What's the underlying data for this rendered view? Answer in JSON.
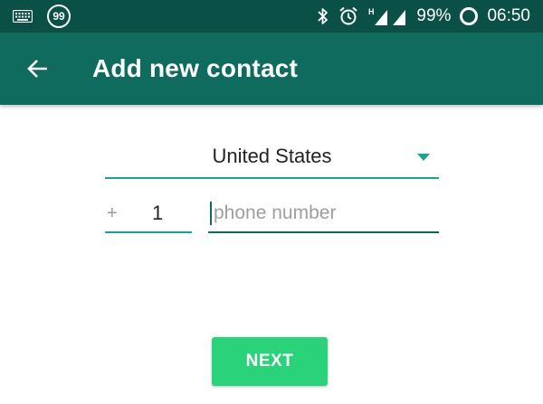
{
  "status_bar": {
    "keyboard_icon": "keyboard-icon",
    "notification_count": "99",
    "bluetooth_icon": "bluetooth-icon",
    "alarm_icon": "alarm-clock-icon",
    "network_type": "H",
    "signal_icon": "cell-signal-icon",
    "battery_percent": "99%",
    "battery_icon": "ring-icon",
    "time": "06:50"
  },
  "app_bar": {
    "back_icon": "arrow-left-icon",
    "title": "Add new contact"
  },
  "form": {
    "country": {
      "selected": "United States",
      "caret_icon": "caret-down-icon"
    },
    "country_code": {
      "prefix": "+",
      "value": "1"
    },
    "phone": {
      "value": "",
      "placeholder": "phone number"
    }
  },
  "actions": {
    "next_label": "NEXT"
  },
  "colors": {
    "status_bar": "#0b5047",
    "app_bar": "#0e6b5e",
    "accent": "#1aa48f",
    "button": "#2ad27a"
  }
}
